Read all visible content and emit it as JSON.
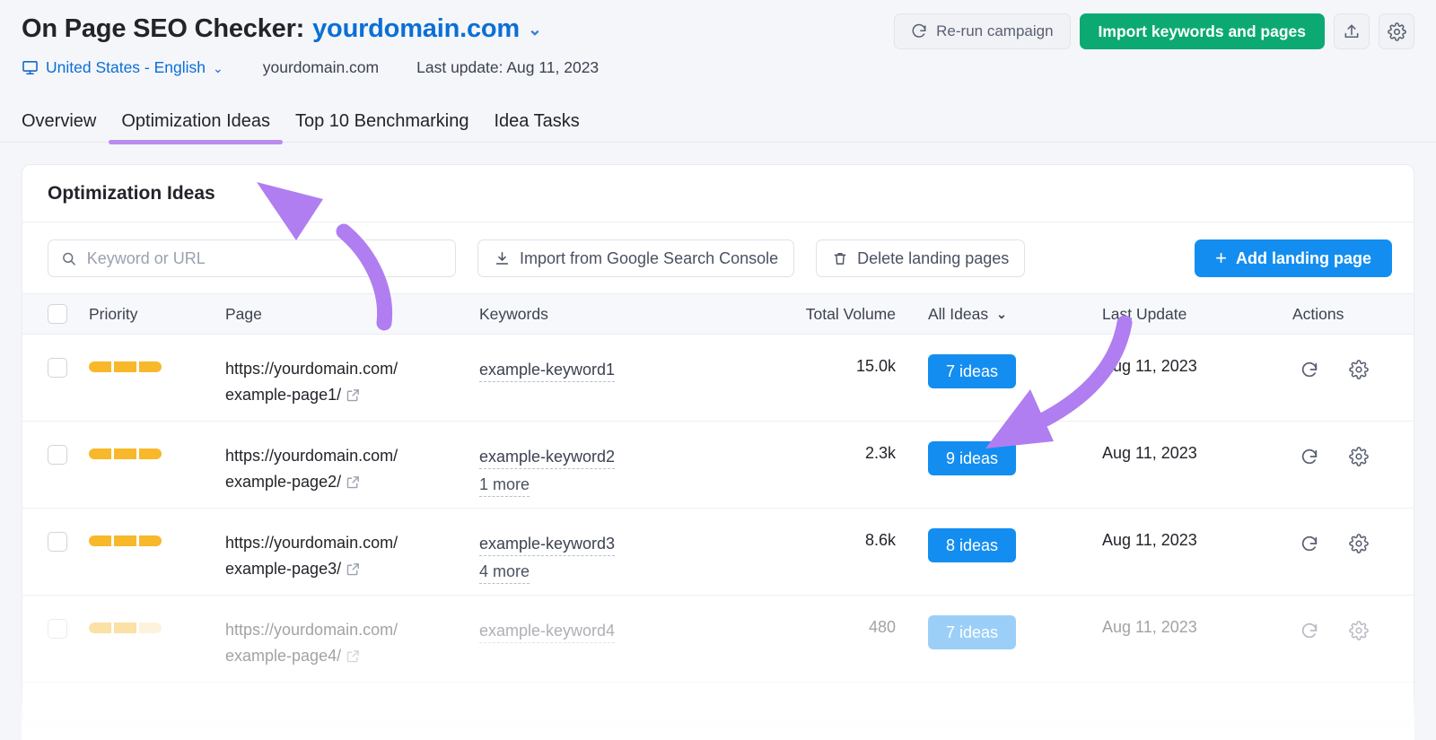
{
  "header": {
    "title_prefix": "On Page SEO Checker:",
    "domain": "yourdomain.com",
    "domain_caret": "⌄",
    "rerun_label": "Re-run campaign",
    "import_label": "Import keywords and pages",
    "export_icon": "export-icon",
    "settings_icon": "gear-icon"
  },
  "meta": {
    "device_icon": "desktop-monitor-icon",
    "locale": "United States - English",
    "locale_caret": "⌄",
    "domain": "yourdomain.com",
    "last_update": "Last update: Aug 11, 2023"
  },
  "tabs": [
    {
      "label": "Overview",
      "active": false
    },
    {
      "label": "Optimization Ideas",
      "active": true
    },
    {
      "label": "Top 10 Benchmarking",
      "active": false
    },
    {
      "label": "Idea Tasks",
      "active": false
    }
  ],
  "card": {
    "title": "Optimization Ideas"
  },
  "toolbar": {
    "search_placeholder": "Keyword or URL",
    "search_value": "",
    "search_icon": "search-icon",
    "import_gsc_label": "Import from Google Search Console",
    "import_gsc_icon": "download-icon",
    "delete_label": "Delete landing pages",
    "delete_icon": "trash-icon",
    "add_label": "Add landing page",
    "add_plus": "+"
  },
  "table": {
    "columns": {
      "priority": "Priority",
      "page": "Page",
      "keywords": "Keywords",
      "total_volume": "Total Volume",
      "ideas": "All Ideas",
      "ideas_caret": "⌄",
      "last_update": "Last Update",
      "actions": "Actions"
    },
    "rows": [
      {
        "priority_filled": 3,
        "priority_total": 3,
        "page_url": "https://yourdomain.com/example-page1/",
        "keyword": "example-keyword1",
        "more": "",
        "total_volume": "15.0k",
        "ideas": "7 ideas",
        "last_update": "Aug 11, 2023",
        "faded": false
      },
      {
        "priority_filled": 3,
        "priority_total": 3,
        "page_url": "https://yourdomain.com/example-page2/",
        "keyword": "example-keyword2",
        "more": "1 more",
        "total_volume": "2.3k",
        "ideas": "9 ideas",
        "last_update": "Aug 11, 2023",
        "faded": false
      },
      {
        "priority_filled": 3,
        "priority_total": 3,
        "page_url": "https://yourdomain.com/example-page3/",
        "keyword": "example-keyword3",
        "more": "4 more",
        "total_volume": "8.6k",
        "ideas": "8 ideas",
        "last_update": "Aug 11, 2023",
        "faded": false
      },
      {
        "priority_filled": 2,
        "priority_total": 3,
        "page_url": "https://yourdomain.com/example-page4/",
        "keyword": "example-keyword4",
        "more": "",
        "total_volume": "480",
        "ideas": "7 ideas",
        "last_update": "Aug 11, 2023",
        "faded": true
      }
    ],
    "row_actions": {
      "refresh_icon": "refresh-icon",
      "settings_icon": "gear-icon"
    }
  },
  "annotations": {
    "color": "#b07ef0",
    "arrow_1_target": "Optimization Ideas tab",
    "arrow_2_target": "7 ideas badge"
  },
  "colors": {
    "accent_blue": "#138ef0",
    "link_blue": "#0b6fd6",
    "green": "#0caa72",
    "priority_orange": "#f7b82b",
    "annotation_purple": "#b07ef0",
    "page_background": "#f5f6fa"
  }
}
